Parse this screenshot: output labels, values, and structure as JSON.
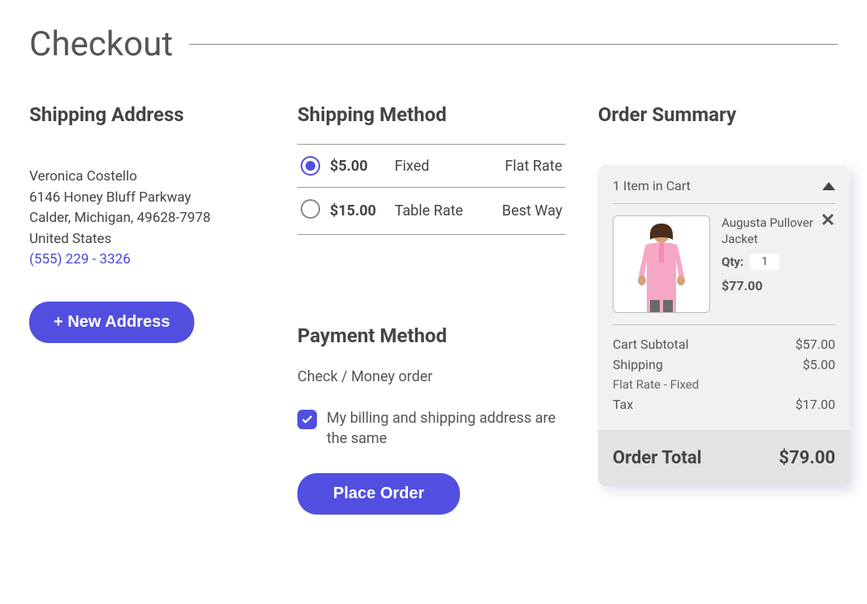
{
  "page": {
    "title": "Checkout"
  },
  "shipping_address": {
    "heading": "Shipping Address",
    "name": "Veronica Costello",
    "street": "6146 Honey Bluff Parkway",
    "city_state_zip": "Calder, Michigan, 49628-7978",
    "country": "United States",
    "phone": "(555) 229 - 3326",
    "new_address_btn": "+ New Address"
  },
  "shipping_method": {
    "heading": "Shipping Method",
    "options": [
      {
        "price": "$5.00",
        "label": "Fixed",
        "carrier": "Flat Rate",
        "selected": true
      },
      {
        "price": "$15.00",
        "label": "Table Rate",
        "carrier": "Best Way",
        "selected": false
      }
    ]
  },
  "payment": {
    "heading": "Payment Method",
    "type": "Check / Money order",
    "same_address_label": "My billing and shipping address are the same",
    "same_address_checked": true,
    "place_order_btn": "Place Order"
  },
  "summary": {
    "heading": "Order Summary",
    "cart_count_label": "1 Item in Cart",
    "item": {
      "name": "Augusta Pullover Jacket",
      "qty_label": "Qty:",
      "qty": "1",
      "price": "$77.00"
    },
    "lines": {
      "subtotal_label": "Cart Subtotal",
      "subtotal_value": "$57.00",
      "shipping_label": "Shipping",
      "shipping_sub": "Flat  Rate - Fixed",
      "shipping_value": "$5.00",
      "tax_label": "Tax",
      "tax_value": "$17.00"
    },
    "order_total_label": "Order Total",
    "order_total_value": "$79.00"
  }
}
